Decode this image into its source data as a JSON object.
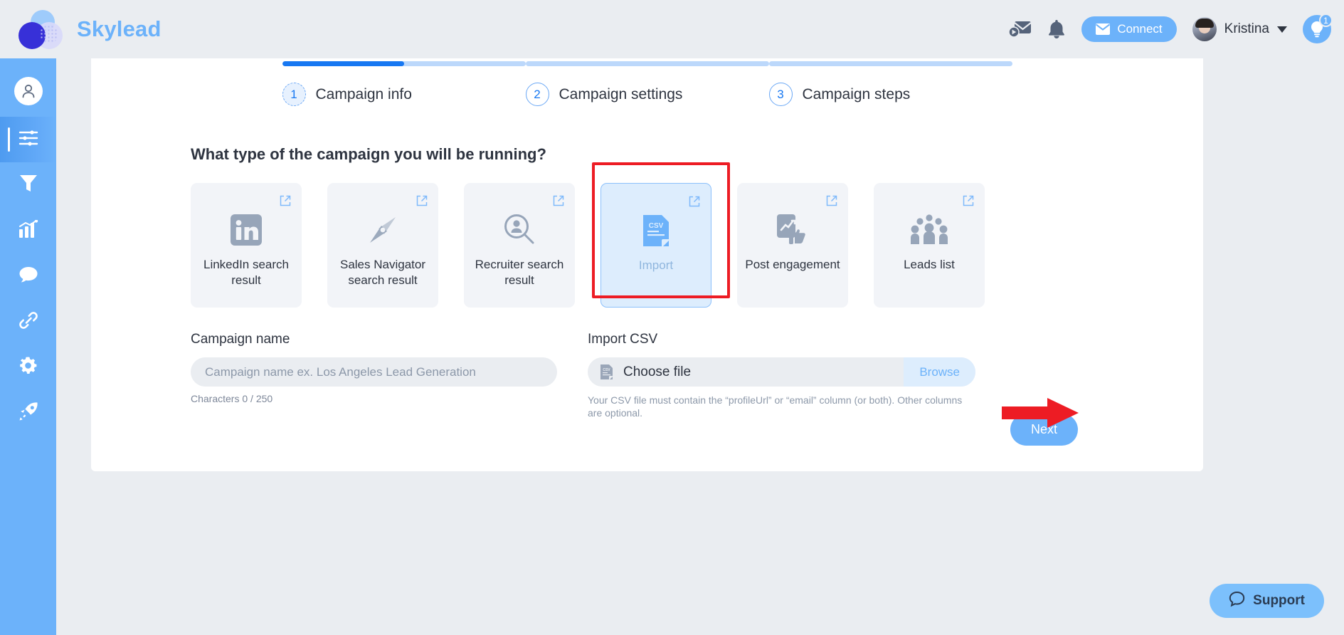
{
  "brand": {
    "name": "Skylead"
  },
  "header": {
    "mail_icon": "mail-send-icon",
    "bell_icon": "bell-icon",
    "connect_label": "Connect",
    "user_name": "Kristina",
    "bulb_badge": "1"
  },
  "sidebar": {
    "items": [
      {
        "name": "profile",
        "icon": "user-icon"
      },
      {
        "name": "campaigns",
        "icon": "sliders-icon",
        "active": true
      },
      {
        "name": "filters",
        "icon": "funnel-icon"
      },
      {
        "name": "reports",
        "icon": "bar-chart-icon"
      },
      {
        "name": "messages",
        "icon": "chat-bubble-icon"
      },
      {
        "name": "integrations",
        "icon": "link-icon"
      },
      {
        "name": "settings",
        "icon": "gear-icon"
      },
      {
        "name": "launch",
        "icon": "rocket-icon"
      }
    ]
  },
  "stepper": {
    "steps": [
      {
        "number": "1",
        "label": "Campaign info",
        "progress": 50,
        "current": true
      },
      {
        "number": "2",
        "label": "Campaign settings",
        "progress": 0,
        "current": false
      },
      {
        "number": "3",
        "label": "Campaign steps",
        "progress": 0,
        "current": false
      }
    ]
  },
  "main": {
    "question": "What type of the campaign you will be running?",
    "campaign_types": [
      {
        "label": "LinkedIn search result",
        "icon": "linkedin-icon",
        "selected": false
      },
      {
        "label": "Sales Navigator search result",
        "icon": "compass-icon",
        "selected": false
      },
      {
        "label": "Recruiter search result",
        "icon": "person-search-icon",
        "selected": false
      },
      {
        "label": "Import",
        "icon": "csv-file-icon",
        "selected": true
      },
      {
        "label": "Post engagement",
        "icon": "post-thumbs-up-icon",
        "selected": false
      },
      {
        "label": "Leads list",
        "icon": "people-group-icon",
        "selected": false
      }
    ],
    "campaign_name": {
      "label": "Campaign name",
      "value": "",
      "placeholder": "Campaign name ex. Los Angeles Lead Generation",
      "char_count": "Characters 0 / 250"
    },
    "import_csv": {
      "label": "Import CSV",
      "file_text": "Choose file",
      "browse_label": "Browse",
      "hint": "Your CSV file must contain the “profileUrl” or “email” column (or both). Other columns are optional."
    },
    "next_label": "Next"
  },
  "support": {
    "label": "Support",
    "icon": "chat-bubble-icon"
  },
  "colors": {
    "brand_blue": "#6cb2fa",
    "progress_blue": "#1778f2",
    "annotation_red": "#ed1c24",
    "page_bg": "#eaedf1"
  }
}
